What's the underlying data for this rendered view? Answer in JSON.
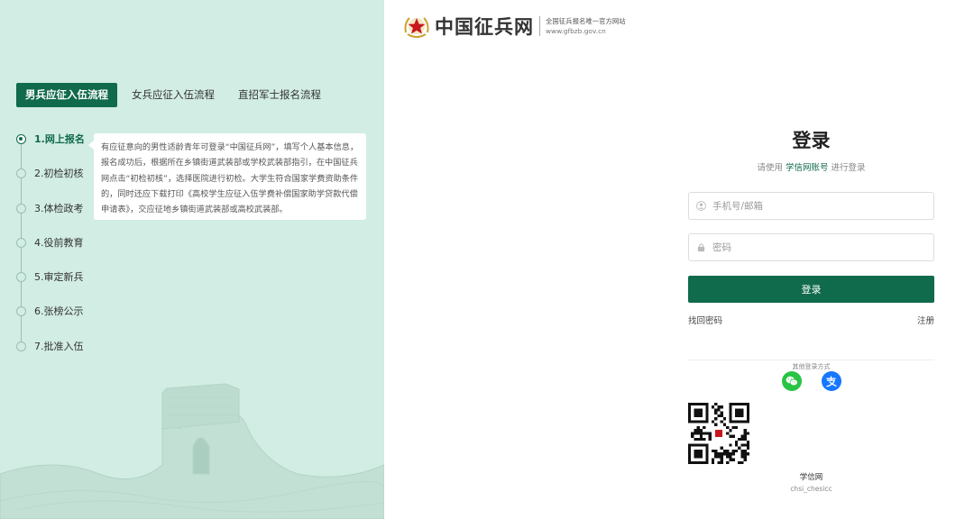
{
  "flow_tabs": [
    {
      "label": "男兵应征入伍流程",
      "active": true
    },
    {
      "label": "女兵应征入伍流程",
      "active": false
    },
    {
      "label": "直招军士报名流程",
      "active": false
    }
  ],
  "steps": [
    {
      "label": "1.网上报名",
      "active": true
    },
    {
      "label": "2.初检初核",
      "active": false
    },
    {
      "label": "3.体检政考",
      "active": false
    },
    {
      "label": "4.役前教育",
      "active": false
    },
    {
      "label": "5.审定新兵",
      "active": false
    },
    {
      "label": "6.张榜公示",
      "active": false
    },
    {
      "label": "7.批准入伍",
      "active": false
    }
  ],
  "step_tip": "有应征意向的男性适龄青年可登录“中国征兵网”，填写个人基本信息，报名成功后，根据所在乡镇街道武装部或学校武装部指引，在中国征兵网点击“初检初核”，选择医院进行初检。大学生符合国家学费资助条件的，同时还应下载打印《高校学生应征入伍学费补偿国家助学贷款代偿申请表》，交应征地乡镇街道武装部或高校武装部。",
  "logo": {
    "name": "中国征兵网",
    "slogan": "全国征兵报名唯一官方网站",
    "url": "www.gfbzb.gov.cn"
  },
  "login": {
    "title": "登录",
    "subtitle_pre": "请使用 ",
    "subtitle_account": "学信网账号",
    "subtitle_post": " 进行登录",
    "username_placeholder": "手机号/邮箱",
    "password_placeholder": "密码",
    "submit_label": "登录",
    "forgot_label": "找回密码",
    "register_label": "注册",
    "other_methods_label": "其他登录方式",
    "qr_label": "学信网",
    "qr_id": "chsi_chesicc"
  },
  "colors": {
    "brand_green": "#106a4c",
    "left_bg": "#d2ede3",
    "wechat_green": "#28c445",
    "alipay_blue": "#1677ff"
  },
  "icons": [
    "star-emblem-icon",
    "user-icon",
    "lock-icon",
    "wechat-icon",
    "alipay-icon",
    "qr-code-icon"
  ]
}
